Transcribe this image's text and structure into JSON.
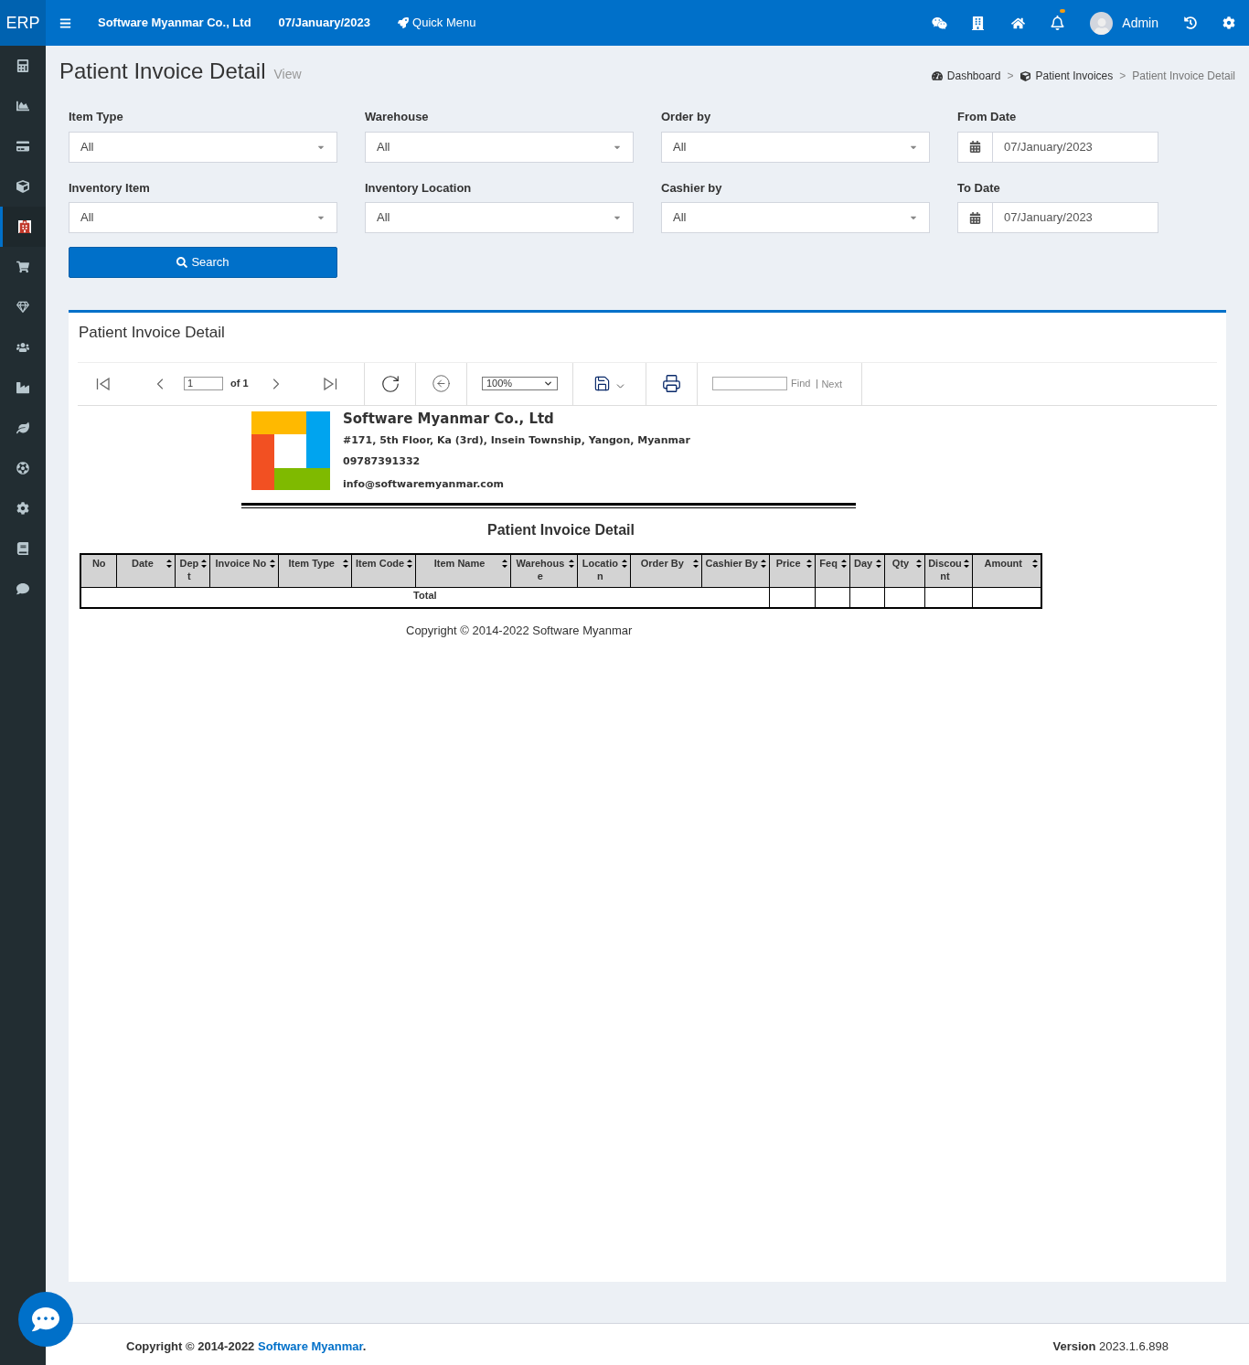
{
  "topbar": {
    "brand": "ERP",
    "company": "Software Myanmar Co., Ltd",
    "date": "07/January/2023",
    "quick_menu": "Quick Menu",
    "user": "Admin",
    "notification_dot": true
  },
  "sidebar": {
    "items": [
      {
        "selected": false
      },
      {
        "selected": false
      },
      {
        "selected": false
      },
      {
        "selected": false
      },
      {
        "selected": true
      },
      {
        "selected": false
      },
      {
        "selected": false
      },
      {
        "selected": false
      },
      {
        "selected": false
      },
      {
        "selected": false
      },
      {
        "selected": false
      },
      {
        "selected": false
      },
      {
        "selected": false
      },
      {
        "selected": false
      }
    ]
  },
  "header": {
    "title": "Patient Invoice Detail",
    "subtitle": "View"
  },
  "breadcrumbs": [
    {
      "label": "Dashboard",
      "kind": "dashboard"
    },
    {
      "label": "Patient Invoices",
      "kind": "cube",
      "separator": ">"
    },
    {
      "label": "Patient Invoice Detail",
      "kind": "current",
      "separator": ">"
    }
  ],
  "filters": [
    {
      "label": "Item Type",
      "value": "All",
      "kind": "select"
    },
    {
      "label": "Warehouse",
      "value": "All",
      "kind": "select"
    },
    {
      "label": "Order by",
      "value": "All",
      "kind": "select"
    },
    {
      "label": "From Date",
      "value": "07/January/2023",
      "kind": "date"
    },
    {
      "label": "Inventory Item",
      "value": "All",
      "kind": "select"
    },
    {
      "label": "Inventory Location",
      "value": "All",
      "kind": "select"
    },
    {
      "label": "Cashier by",
      "value": "All",
      "kind": "select"
    },
    {
      "label": "To Date",
      "value": "07/January/2023",
      "kind": "date"
    }
  ],
  "search_button": "Search",
  "panel": {
    "title": "Patient Invoice Detail"
  },
  "report_toolbar": {
    "page": "1",
    "page_count": "of 1",
    "zoom": "100%",
    "find": "Find",
    "next": "Next"
  },
  "report": {
    "company": "Software Myanmar Co., Ltd",
    "address": "#171, 5th Floor, Ka (3rd), Insein Township, Yangon, Myanmar",
    "phone": "09787391332",
    "email": "info@softwaremyanmar.com",
    "title": "Patient Invoice Detail",
    "columns": [
      {
        "label": "No",
        "sortable": false
      },
      {
        "label": "Date",
        "sortable": true
      },
      {
        "label": "Dept",
        "sortable": true
      },
      {
        "label": "Invoice No",
        "sortable": true
      },
      {
        "label": "Item Type",
        "sortable": true
      },
      {
        "label": "Item Code",
        "sortable": true
      },
      {
        "label": "Item Name",
        "sortable": true
      },
      {
        "label": "Warehouse",
        "sortable": true
      },
      {
        "label": "Location",
        "sortable": true
      },
      {
        "label": "Order By",
        "sortable": true
      },
      {
        "label": "Cashier By",
        "sortable": true
      },
      {
        "label": "Price",
        "sortable": true
      },
      {
        "label": "Feq",
        "sortable": true
      },
      {
        "label": "Day",
        "sortable": true
      },
      {
        "label": "Qty",
        "sortable": true
      },
      {
        "label": "Discount",
        "sortable": true
      },
      {
        "label": "Amount",
        "sortable": true
      }
    ],
    "total_label": "Total",
    "copyright": "Copyright © 2014-2022 Software Myanmar"
  },
  "footer": {
    "copyright": "Copyright © 2014-2022",
    "link": "Software Myanmar",
    "link_suffix": ".",
    "version_label": "Version",
    "version": "2023.1.6.898"
  }
}
